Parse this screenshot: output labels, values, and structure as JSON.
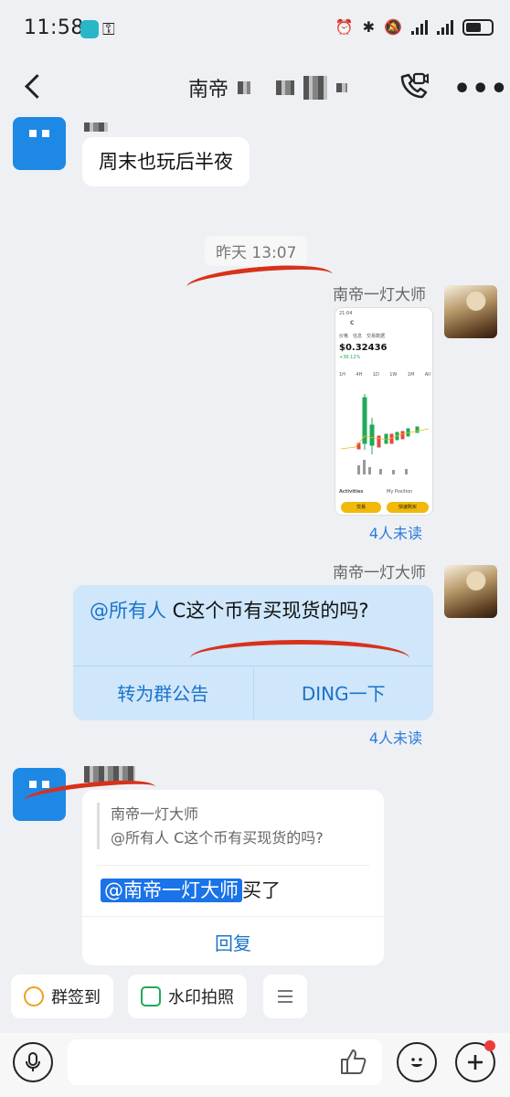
{
  "status_bar": {
    "time": "11:58",
    "key_icon": "key-icon",
    "right_icons": [
      "alarm-icon",
      "bluetooth-icon",
      "mute-icon",
      "signal-icon",
      "signal-icon",
      "battery-icon"
    ]
  },
  "header": {
    "title": "南帝",
    "back_icon": "chevron-left-icon",
    "video_call_icon": "video-call-icon",
    "more_icon": "more-icon"
  },
  "messages": {
    "m1": {
      "text": "周末也玩后半夜"
    },
    "timestamp": "昨天 13:07",
    "m2": {
      "sender": "南帝一灯大师",
      "unread": "4人未读",
      "shot": {
        "status_time": "21:04",
        "coin_name": "C",
        "tabs": [
          "价格",
          "信息",
          "交易数据"
        ],
        "price": "$0.32436",
        "change": "+36.12%",
        "intervals": [
          "1H",
          "4H",
          "1D",
          "1W",
          "1M",
          "All"
        ],
        "activities": "Activities",
        "position": "My Position",
        "btn_trade": "交易",
        "btn_buy": "快速购买"
      }
    },
    "m3": {
      "sender": "南帝一灯大师",
      "mention": "@所有人",
      "text": " C这个币有买现货的吗?",
      "action_announce": "转为群公告",
      "action_ding": "DING一下",
      "unread": "4人未读"
    },
    "m4": {
      "quote_sender": "南帝一灯大师",
      "quote_text": "@所有人 C这个币有买现货的吗?",
      "mention": "@南帝一灯大师",
      "text": "买了",
      "reply": "回复"
    }
  },
  "quick_bar": {
    "checkin": "群签到",
    "watermark": "水印拍照",
    "menu_icon": "menu-icon"
  },
  "input_bar": {
    "voice_icon": "microphone-icon",
    "placeholder": "",
    "like_icon": "thumbs-up-icon",
    "emoji_icon": "emoji-icon",
    "plus_icon": "plus-icon"
  }
}
